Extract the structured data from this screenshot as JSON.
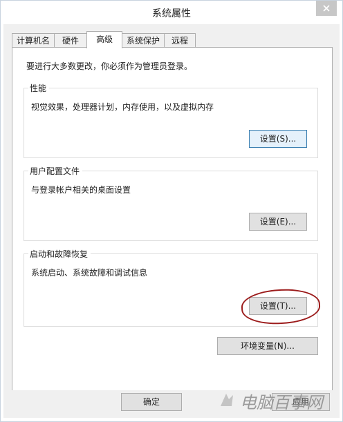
{
  "window": {
    "title": "系统属性"
  },
  "tabs": [
    {
      "label": "计算机名"
    },
    {
      "label": "硬件"
    },
    {
      "label": "高级"
    },
    {
      "label": "系统保护"
    },
    {
      "label": "远程"
    }
  ],
  "active_tab": "高级",
  "admin_note": "要进行大多数更改，你必须作为管理员登录。",
  "performance": {
    "title": "性能",
    "description": "视觉效果，处理器计划，内存使用，以及虚拟内存",
    "button": "设置(S)..."
  },
  "user_profiles": {
    "title": "用户配置文件",
    "description": "与登录帐户相关的桌面设置",
    "button": "设置(E)..."
  },
  "startup_recovery": {
    "title": "启动和故障恢复",
    "description": "系统启动、系统故障和调试信息",
    "button": "设置(T)..."
  },
  "env_button": "环境变量(N)...",
  "footer": {
    "ok": "确定",
    "apply": "应用"
  },
  "watermark": "电脑百事网",
  "colors": {
    "annotation": "#9c1c1c",
    "focus_border": "#3c7fb1",
    "close_button": "#c7c7c7"
  }
}
